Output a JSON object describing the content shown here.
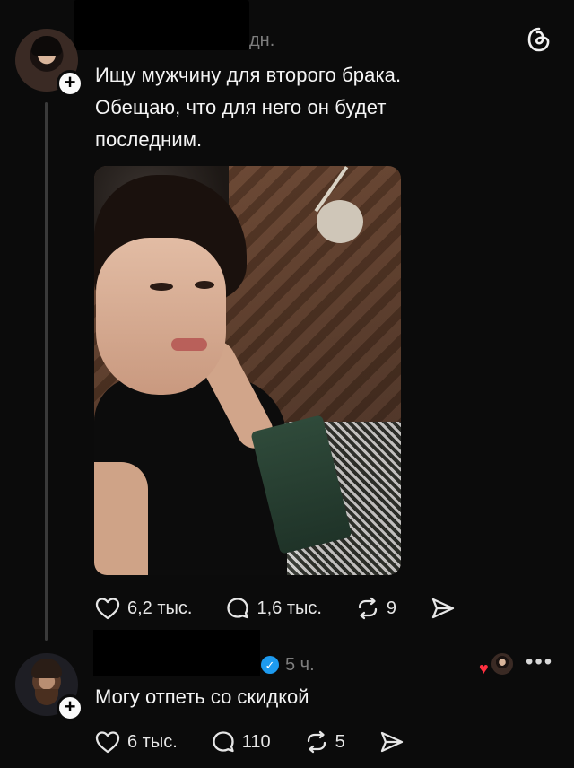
{
  "post": {
    "time": "дн.",
    "text_line1": "Ищу мужчину для второго брака.",
    "text_line2": "Обещаю, что для него он будет",
    "text_line3": "последним.",
    "photo_icon": "photo",
    "actions": {
      "likes": "6,2 тыс.",
      "comments": "1,6 тыс.",
      "reposts": "9"
    }
  },
  "reply": {
    "time": "5 ч.",
    "verified_icon": "verified-check",
    "text": "Могу отпеть со скидкой",
    "actions": {
      "likes": "6 тыс.",
      "comments": "110",
      "reposts": "5"
    }
  },
  "icons": {
    "follow": "+",
    "app_logo": "threads-logo",
    "more": "•••",
    "liked_heart": "♥",
    "verified": "✓"
  },
  "colors": {
    "background": "#0b0b0b",
    "text": "#f5f5f5",
    "muted": "#7d7d7d",
    "verified": "#1d9bf0",
    "heart": "#ff3040"
  }
}
